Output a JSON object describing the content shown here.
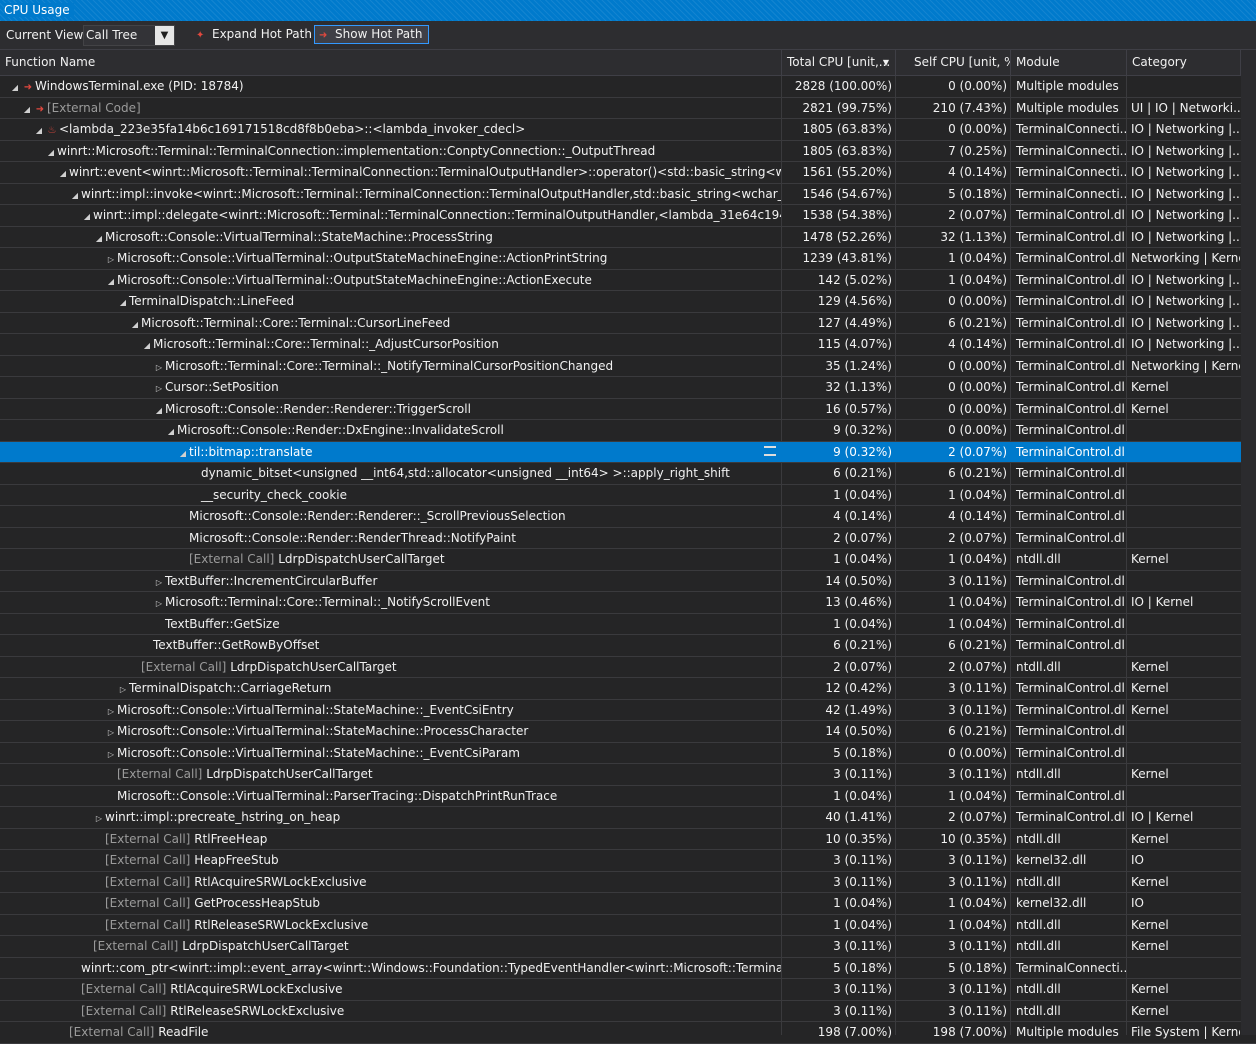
{
  "window": {
    "title": "CPU Usage"
  },
  "toolbar": {
    "current_view_label": "Current View:",
    "current_view_value": "Call Tree",
    "expand_hot_path": "Expand Hot Path",
    "show_hot_path": "Show Hot Path"
  },
  "columns": {
    "function_name": "Function Name",
    "total_cpu": "Total CPU [unit,...",
    "self_cpu": "Self CPU [unit, %]",
    "module": "Module",
    "category": "Category"
  },
  "rows": [
    {
      "depth": 0,
      "tw": "open",
      "hot": "path",
      "ext": "",
      "name": "WindowsTerminal.exe (PID: 18784)",
      "total": "2828 (100.00%)",
      "self": "0 (0.00%)",
      "module": "Multiple modules",
      "category": ""
    },
    {
      "depth": 1,
      "tw": "open",
      "hot": "path",
      "ext": "",
      "name": "[External Code]",
      "nameExt": true,
      "total": "2821 (99.75%)",
      "self": "210 (7.43%)",
      "module": "Multiple modules",
      "category": "UI | IO | Networki..."
    },
    {
      "depth": 2,
      "tw": "open",
      "hot": "fire",
      "ext": "",
      "name": "<lambda_223e35fa14b6c169171518cd8f8b0eba>::<lambda_invoker_cdecl>",
      "total": "1805 (63.83%)",
      "self": "0 (0.00%)",
      "module": "TerminalConnecti...",
      "category": "IO | Networking |..."
    },
    {
      "depth": 3,
      "tw": "open",
      "hot": "",
      "ext": "",
      "name": "winrt::Microsoft::Terminal::TerminalConnection::implementation::ConptyConnection::_OutputThread",
      "total": "1805 (63.83%)",
      "self": "7 (0.25%)",
      "module": "TerminalConnecti...",
      "category": "IO | Networking |..."
    },
    {
      "depth": 4,
      "tw": "open",
      "hot": "",
      "ext": "",
      "name": "winrt::event<winrt::Microsoft::Terminal::TerminalConnection::TerminalOutputHandler>::operator()<std::basic_string<wchar_t,std::ch...",
      "total": "1561 (55.20%)",
      "self": "4 (0.14%)",
      "module": "TerminalConnecti...",
      "category": "IO | Networking |..."
    },
    {
      "depth": 5,
      "tw": "open",
      "hot": "",
      "ext": "",
      "name": "winrt::impl::invoke<winrt::Microsoft::Terminal::TerminalConnection::TerminalOutputHandler,std::basic_string<wchar_t,std::char_tr...",
      "total": "1546 (54.67%)",
      "self": "5 (0.18%)",
      "module": "TerminalConnecti...",
      "category": "IO | Networking |..."
    },
    {
      "depth": 6,
      "tw": "open",
      "hot": "",
      "ext": "",
      "name": "winrt::impl::delegate<winrt::Microsoft::Terminal::TerminalConnection::TerminalOutputHandler,<lambda_31e64c19412870c522...",
      "total": "1538 (54.38%)",
      "self": "2 (0.07%)",
      "module": "TerminalControl.dll",
      "category": "IO | Networking |..."
    },
    {
      "depth": 7,
      "tw": "open",
      "hot": "",
      "ext": "",
      "name": "Microsoft::Console::VirtualTerminal::StateMachine::ProcessString",
      "total": "1478 (52.26%)",
      "self": "32 (1.13%)",
      "module": "TerminalControl.dll",
      "category": "IO | Networking |..."
    },
    {
      "depth": 8,
      "tw": "closed",
      "hot": "",
      "ext": "",
      "name": "Microsoft::Console::VirtualTerminal::OutputStateMachineEngine::ActionPrintString",
      "total": "1239 (43.81%)",
      "self": "1 (0.04%)",
      "module": "TerminalControl.dll",
      "category": "Networking | Kernel"
    },
    {
      "depth": 8,
      "tw": "open",
      "hot": "",
      "ext": "",
      "name": "Microsoft::Console::VirtualTerminal::OutputStateMachineEngine::ActionExecute",
      "total": "142 (5.02%)",
      "self": "1 (0.04%)",
      "module": "TerminalControl.dll",
      "category": "IO | Networking |..."
    },
    {
      "depth": 9,
      "tw": "open",
      "hot": "",
      "ext": "",
      "name": "TerminalDispatch::LineFeed",
      "total": "129 (4.56%)",
      "self": "0 (0.00%)",
      "module": "TerminalControl.dll",
      "category": "IO | Networking |..."
    },
    {
      "depth": 10,
      "tw": "open",
      "hot": "",
      "ext": "",
      "name": "Microsoft::Terminal::Core::Terminal::CursorLineFeed",
      "total": "127 (4.49%)",
      "self": "6 (0.21%)",
      "module": "TerminalControl.dll",
      "category": "IO | Networking |..."
    },
    {
      "depth": 11,
      "tw": "open",
      "hot": "",
      "ext": "",
      "name": "Microsoft::Terminal::Core::Terminal::_AdjustCursorPosition",
      "total": "115 (4.07%)",
      "self": "4 (0.14%)",
      "module": "TerminalControl.dll",
      "category": "IO | Networking |..."
    },
    {
      "depth": 12,
      "tw": "closed",
      "hot": "",
      "ext": "",
      "name": "Microsoft::Terminal::Core::Terminal::_NotifyTerminalCursorPositionChanged",
      "total": "35 (1.24%)",
      "self": "0 (0.00%)",
      "module": "TerminalControl.dll",
      "category": "Networking | Kernel"
    },
    {
      "depth": 12,
      "tw": "closed",
      "hot": "",
      "ext": "",
      "name": "Cursor::SetPosition",
      "total": "32 (1.13%)",
      "self": "0 (0.00%)",
      "module": "TerminalControl.dll",
      "category": "Kernel"
    },
    {
      "depth": 12,
      "tw": "open",
      "hot": "",
      "ext": "",
      "name": "Microsoft::Console::Render::Renderer::TriggerScroll",
      "total": "16 (0.57%)",
      "self": "0 (0.00%)",
      "module": "TerminalControl.dll",
      "category": "Kernel"
    },
    {
      "depth": 13,
      "tw": "open",
      "hot": "",
      "ext": "",
      "name": "Microsoft::Console::Render::DxEngine::InvalidateScroll",
      "total": "9 (0.32%)",
      "self": "0 (0.00%)",
      "module": "TerminalControl.dll",
      "category": ""
    },
    {
      "depth": 14,
      "tw": "open",
      "hot": "",
      "ext": "",
      "name": "til::bitmap::translate",
      "total": "9 (0.32%)",
      "self": "2 (0.07%)",
      "module": "TerminalControl.dll",
      "category": "",
      "selected": true
    },
    {
      "depth": 15,
      "tw": "none",
      "hot": "",
      "ext": "",
      "name": "dynamic_bitset<unsigned __int64,std::allocator<unsigned __int64> >::apply_right_shift",
      "total": "6 (0.21%)",
      "self": "6 (0.21%)",
      "module": "TerminalControl.dll",
      "category": ""
    },
    {
      "depth": 15,
      "tw": "none",
      "hot": "",
      "ext": "",
      "name": "__security_check_cookie",
      "total": "1 (0.04%)",
      "self": "1 (0.04%)",
      "module": "TerminalControl.dll",
      "category": ""
    },
    {
      "depth": 14,
      "tw": "none",
      "hot": "",
      "ext": "",
      "name": "Microsoft::Console::Render::Renderer::_ScrollPreviousSelection",
      "total": "4 (0.14%)",
      "self": "4 (0.14%)",
      "module": "TerminalControl.dll",
      "category": ""
    },
    {
      "depth": 14,
      "tw": "none",
      "hot": "",
      "ext": "",
      "name": "Microsoft::Console::Render::RenderThread::NotifyPaint",
      "total": "2 (0.07%)",
      "self": "2 (0.07%)",
      "module": "TerminalControl.dll",
      "category": ""
    },
    {
      "depth": 14,
      "tw": "none",
      "hot": "",
      "ext": "[External Call]",
      "name": "LdrpDispatchUserCallTarget",
      "total": "1 (0.04%)",
      "self": "1 (0.04%)",
      "module": "ntdll.dll",
      "category": "Kernel"
    },
    {
      "depth": 12,
      "tw": "closed",
      "hot": "",
      "ext": "",
      "name": "TextBuffer::IncrementCircularBuffer",
      "total": "14 (0.50%)",
      "self": "3 (0.11%)",
      "module": "TerminalControl.dll",
      "category": ""
    },
    {
      "depth": 12,
      "tw": "closed",
      "hot": "",
      "ext": "",
      "name": "Microsoft::Terminal::Core::Terminal::_NotifyScrollEvent",
      "total": "13 (0.46%)",
      "self": "1 (0.04%)",
      "module": "TerminalControl.dll",
      "category": "IO | Kernel"
    },
    {
      "depth": 12,
      "tw": "none",
      "hot": "",
      "ext": "",
      "name": "TextBuffer::GetSize",
      "total": "1 (0.04%)",
      "self": "1 (0.04%)",
      "module": "TerminalControl.dll",
      "category": ""
    },
    {
      "depth": 11,
      "tw": "none",
      "hot": "",
      "ext": "",
      "name": "TextBuffer::GetRowByOffset",
      "total": "6 (0.21%)",
      "self": "6 (0.21%)",
      "module": "TerminalControl.dll",
      "category": ""
    },
    {
      "depth": 10,
      "tw": "none",
      "hot": "",
      "ext": "[External Call]",
      "name": "LdrpDispatchUserCallTarget",
      "total": "2 (0.07%)",
      "self": "2 (0.07%)",
      "module": "ntdll.dll",
      "category": "Kernel"
    },
    {
      "depth": 9,
      "tw": "closed",
      "hot": "",
      "ext": "",
      "name": "TerminalDispatch::CarriageReturn",
      "total": "12 (0.42%)",
      "self": "3 (0.11%)",
      "module": "TerminalControl.dll",
      "category": "Kernel"
    },
    {
      "depth": 8,
      "tw": "closed",
      "hot": "",
      "ext": "",
      "name": "Microsoft::Console::VirtualTerminal::StateMachine::_EventCsiEntry",
      "total": "42 (1.49%)",
      "self": "3 (0.11%)",
      "module": "TerminalControl.dll",
      "category": "Kernel"
    },
    {
      "depth": 8,
      "tw": "closed",
      "hot": "",
      "ext": "",
      "name": "Microsoft::Console::VirtualTerminal::StateMachine::ProcessCharacter",
      "total": "14 (0.50%)",
      "self": "6 (0.21%)",
      "module": "TerminalControl.dll",
      "category": ""
    },
    {
      "depth": 8,
      "tw": "closed",
      "hot": "",
      "ext": "",
      "name": "Microsoft::Console::VirtualTerminal::StateMachine::_EventCsiParam",
      "total": "5 (0.18%)",
      "self": "0 (0.00%)",
      "module": "TerminalControl.dll",
      "category": ""
    },
    {
      "depth": 8,
      "tw": "none",
      "hot": "",
      "ext": "[External Call]",
      "name": "LdrpDispatchUserCallTarget",
      "total": "3 (0.11%)",
      "self": "3 (0.11%)",
      "module": "ntdll.dll",
      "category": "Kernel"
    },
    {
      "depth": 8,
      "tw": "none",
      "hot": "",
      "ext": "",
      "name": "Microsoft::Console::VirtualTerminal::ParserTracing::DispatchPrintRunTrace",
      "total": "1 (0.04%)",
      "self": "1 (0.04%)",
      "module": "TerminalControl.dll",
      "category": ""
    },
    {
      "depth": 7,
      "tw": "closed",
      "hot": "",
      "ext": "",
      "name": "winrt::impl::precreate_hstring_on_heap",
      "total": "40 (1.41%)",
      "self": "2 (0.07%)",
      "module": "TerminalControl.dll",
      "category": "IO | Kernel"
    },
    {
      "depth": 7,
      "tw": "none",
      "hot": "",
      "ext": "[External Call]",
      "name": "RtlFreeHeap",
      "total": "10 (0.35%)",
      "self": "10 (0.35%)",
      "module": "ntdll.dll",
      "category": "Kernel"
    },
    {
      "depth": 7,
      "tw": "none",
      "hot": "",
      "ext": "[External Call]",
      "name": "HeapFreeStub",
      "total": "3 (0.11%)",
      "self": "3 (0.11%)",
      "module": "kernel32.dll",
      "category": "IO"
    },
    {
      "depth": 7,
      "tw": "none",
      "hot": "",
      "ext": "[External Call]",
      "name": "RtlAcquireSRWLockExclusive",
      "total": "3 (0.11%)",
      "self": "3 (0.11%)",
      "module": "ntdll.dll",
      "category": "Kernel"
    },
    {
      "depth": 7,
      "tw": "none",
      "hot": "",
      "ext": "[External Call]",
      "name": "GetProcessHeapStub",
      "total": "1 (0.04%)",
      "self": "1 (0.04%)",
      "module": "kernel32.dll",
      "category": "IO"
    },
    {
      "depth": 7,
      "tw": "none",
      "hot": "",
      "ext": "[External Call]",
      "name": "RtlReleaseSRWLockExclusive",
      "total": "1 (0.04%)",
      "self": "1 (0.04%)",
      "module": "ntdll.dll",
      "category": "Kernel"
    },
    {
      "depth": 6,
      "tw": "none",
      "hot": "",
      "ext": "[External Call]",
      "name": "LdrpDispatchUserCallTarget",
      "total": "3 (0.11%)",
      "self": "3 (0.11%)",
      "module": "ntdll.dll",
      "category": "Kernel"
    },
    {
      "depth": 5,
      "tw": "none",
      "hot": "",
      "ext": "",
      "name": "winrt::com_ptr<winrt::impl::event_array<winrt::Windows::Foundation::TypedEventHandler<winrt::Microsoft::Terminal::TerminalCo...",
      "total": "5 (0.18%)",
      "self": "5 (0.18%)",
      "module": "TerminalConnecti...",
      "category": ""
    },
    {
      "depth": 5,
      "tw": "none",
      "hot": "",
      "ext": "[External Call]",
      "name": "RtlAcquireSRWLockExclusive",
      "total": "3 (0.11%)",
      "self": "3 (0.11%)",
      "module": "ntdll.dll",
      "category": "Kernel"
    },
    {
      "depth": 5,
      "tw": "none",
      "hot": "",
      "ext": "[External Call]",
      "name": "RtlReleaseSRWLockExclusive",
      "total": "3 (0.11%)",
      "self": "3 (0.11%)",
      "module": "ntdll.dll",
      "category": "Kernel"
    },
    {
      "depth": 4,
      "tw": "none",
      "hot": "",
      "ext": "[External Call]",
      "name": "ReadFile",
      "total": "198 (7.00%)",
      "self": "198 (7.00%)",
      "module": "Multiple modules",
      "category": "File System | Kernel"
    }
  ]
}
